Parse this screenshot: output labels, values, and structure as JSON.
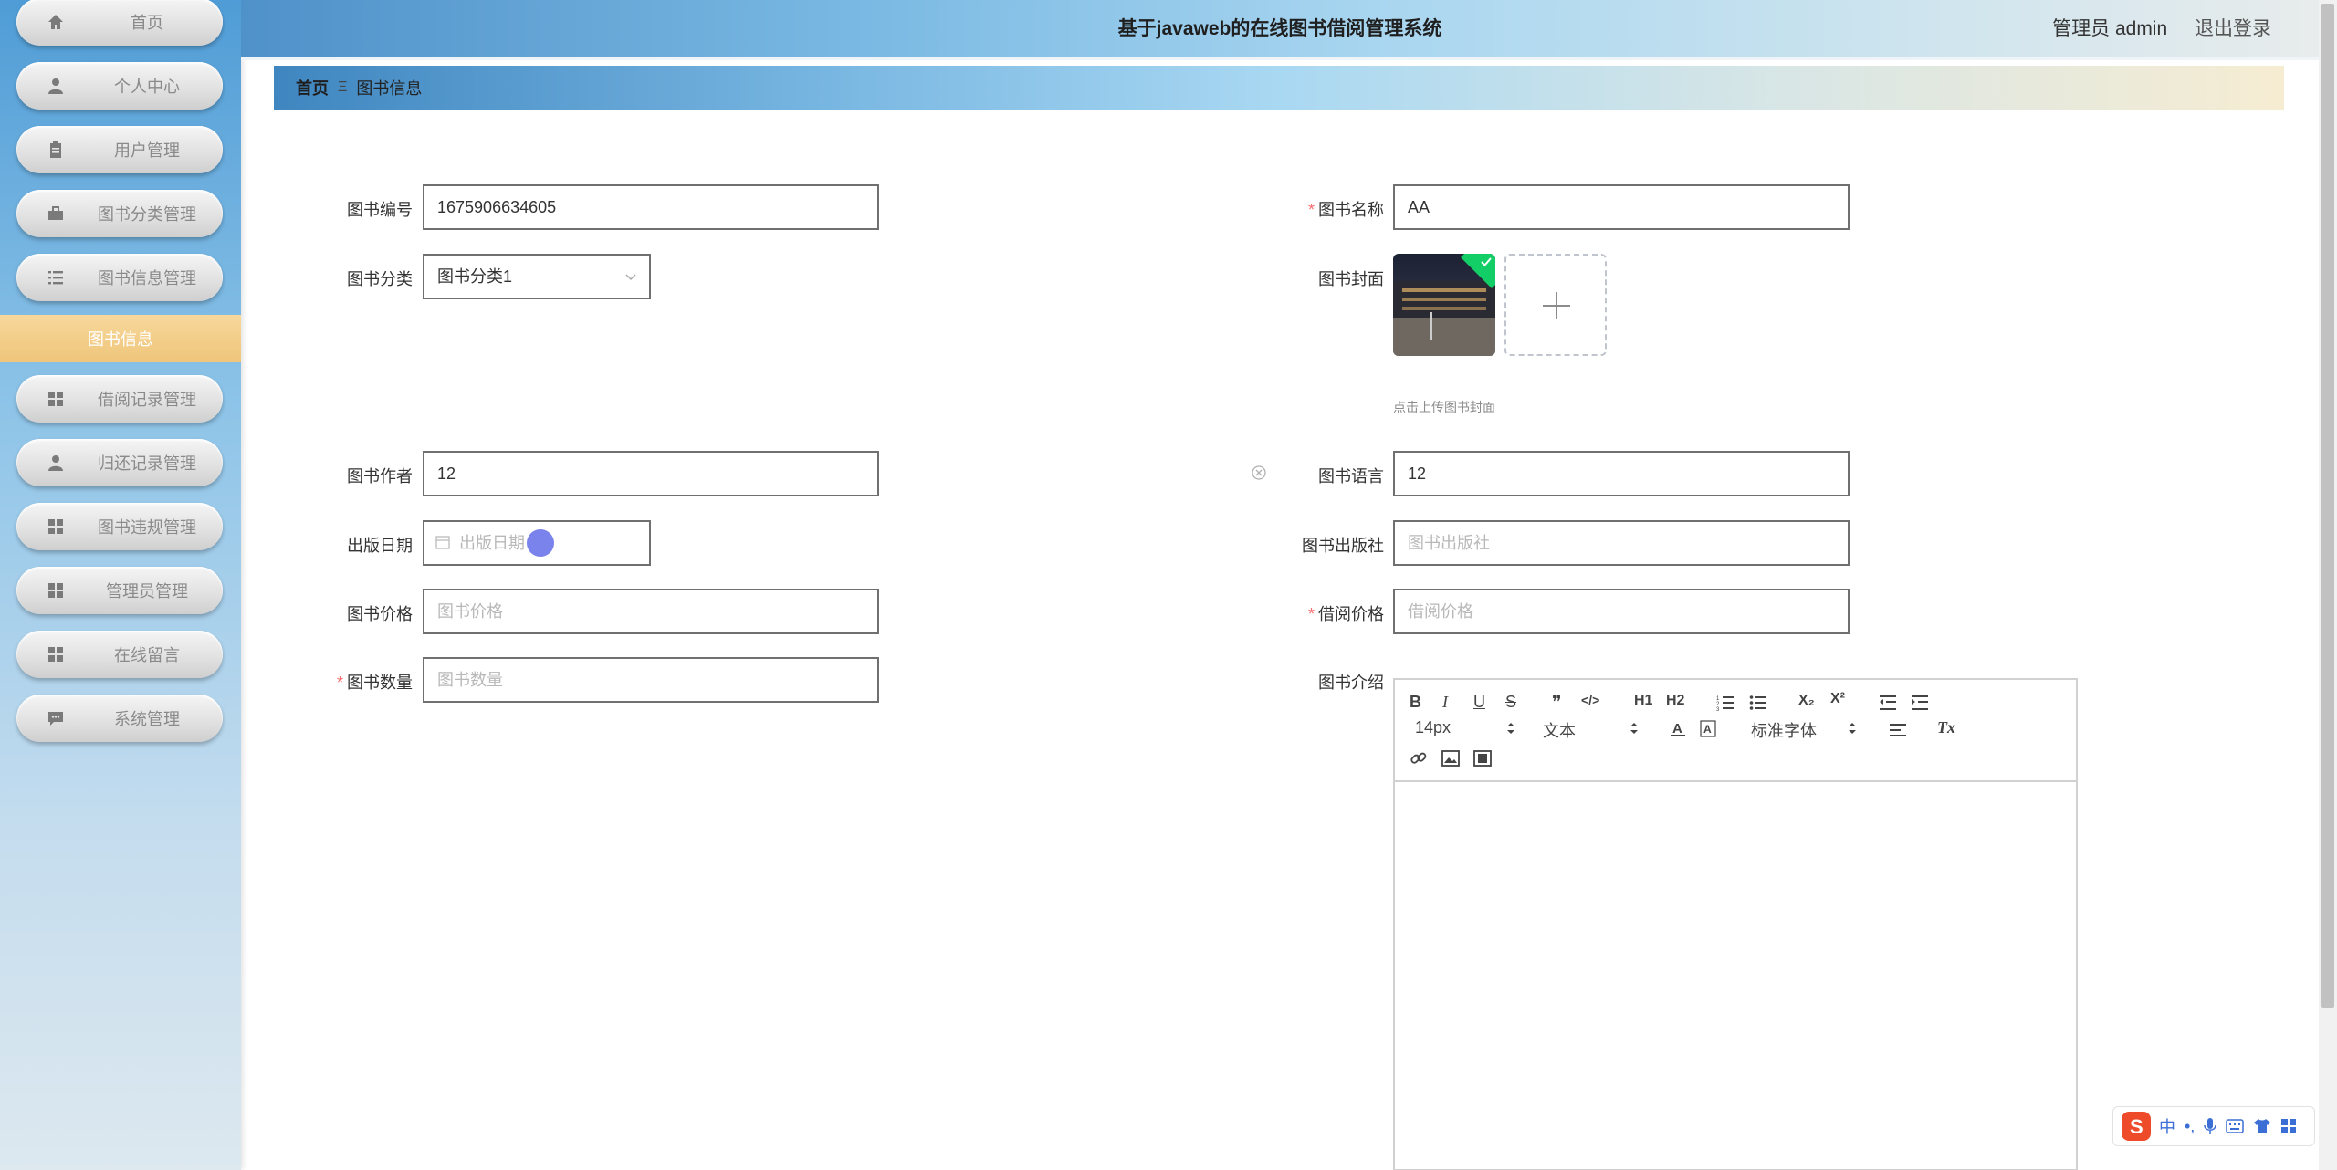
{
  "header": {
    "title": "基于javaweb的在线图书借阅管理系统",
    "role": "管理员 admin",
    "logout": "退出登录"
  },
  "sidebar": {
    "items": [
      {
        "label": "首页",
        "icon": "home-icon"
      },
      {
        "label": "个人中心",
        "icon": "person-icon"
      },
      {
        "label": "用户管理",
        "icon": "clipboard-icon"
      },
      {
        "label": "图书分类管理",
        "icon": "briefcase-icon"
      },
      {
        "label": "图书信息管理",
        "icon": "list-icon"
      },
      {
        "label": "借阅记录管理",
        "icon": "grid-icon"
      },
      {
        "label": "归还记录管理",
        "icon": "person-icon"
      },
      {
        "label": "图书违规管理",
        "icon": "grid-icon"
      },
      {
        "label": "管理员管理",
        "icon": "grid-icon"
      },
      {
        "label": "在线留言",
        "icon": "grid-icon"
      },
      {
        "label": "系统管理",
        "icon": "chat-icon"
      }
    ],
    "active_sub": "图书信息",
    "colors": {
      "active_sub_bg": "#efc57a",
      "menu_label": "#8a8a8a"
    }
  },
  "breadcrumb": {
    "home": "首页",
    "separator": "Ξ",
    "current": "图书信息"
  },
  "form": {
    "book_no": {
      "label": "图书编号",
      "value": "1675906634605"
    },
    "book_name": {
      "label": "图书名称",
      "value": "AA",
      "required": true
    },
    "category": {
      "label": "图书分类",
      "value": "图书分类1"
    },
    "cover": {
      "label": "图书封面",
      "tip": "点击上传图书封面"
    },
    "author": {
      "label": "图书作者",
      "value": "12"
    },
    "language": {
      "label": "图书语言",
      "value": "12"
    },
    "publish_date": {
      "label": "出版日期",
      "placeholder": "出版日期"
    },
    "publisher": {
      "label": "图书出版社",
      "placeholder": "图书出版社"
    },
    "price": {
      "label": "图书价格",
      "placeholder": "图书价格"
    },
    "borrow_price": {
      "label": "借阅价格",
      "placeholder": "借阅价格",
      "required": true
    },
    "quantity": {
      "label": "图书数量",
      "placeholder": "图书数量",
      "required": true
    },
    "intro": {
      "label": "图书介绍"
    }
  },
  "editor": {
    "font_size": "14px",
    "text_style": "文本",
    "font_family": "标准字体",
    "buttons": {
      "bold": "B",
      "italic": "I",
      "underline": "U",
      "strike": "S",
      "quote": "❞",
      "code": "</>",
      "h1": "H1",
      "h2": "H2",
      "sub": "X₂",
      "sup": "X²",
      "clean": "Tx"
    }
  },
  "ime": {
    "lang": "中"
  },
  "colors": {
    "required": "#f56c6c",
    "accent": "#3f86c0"
  }
}
